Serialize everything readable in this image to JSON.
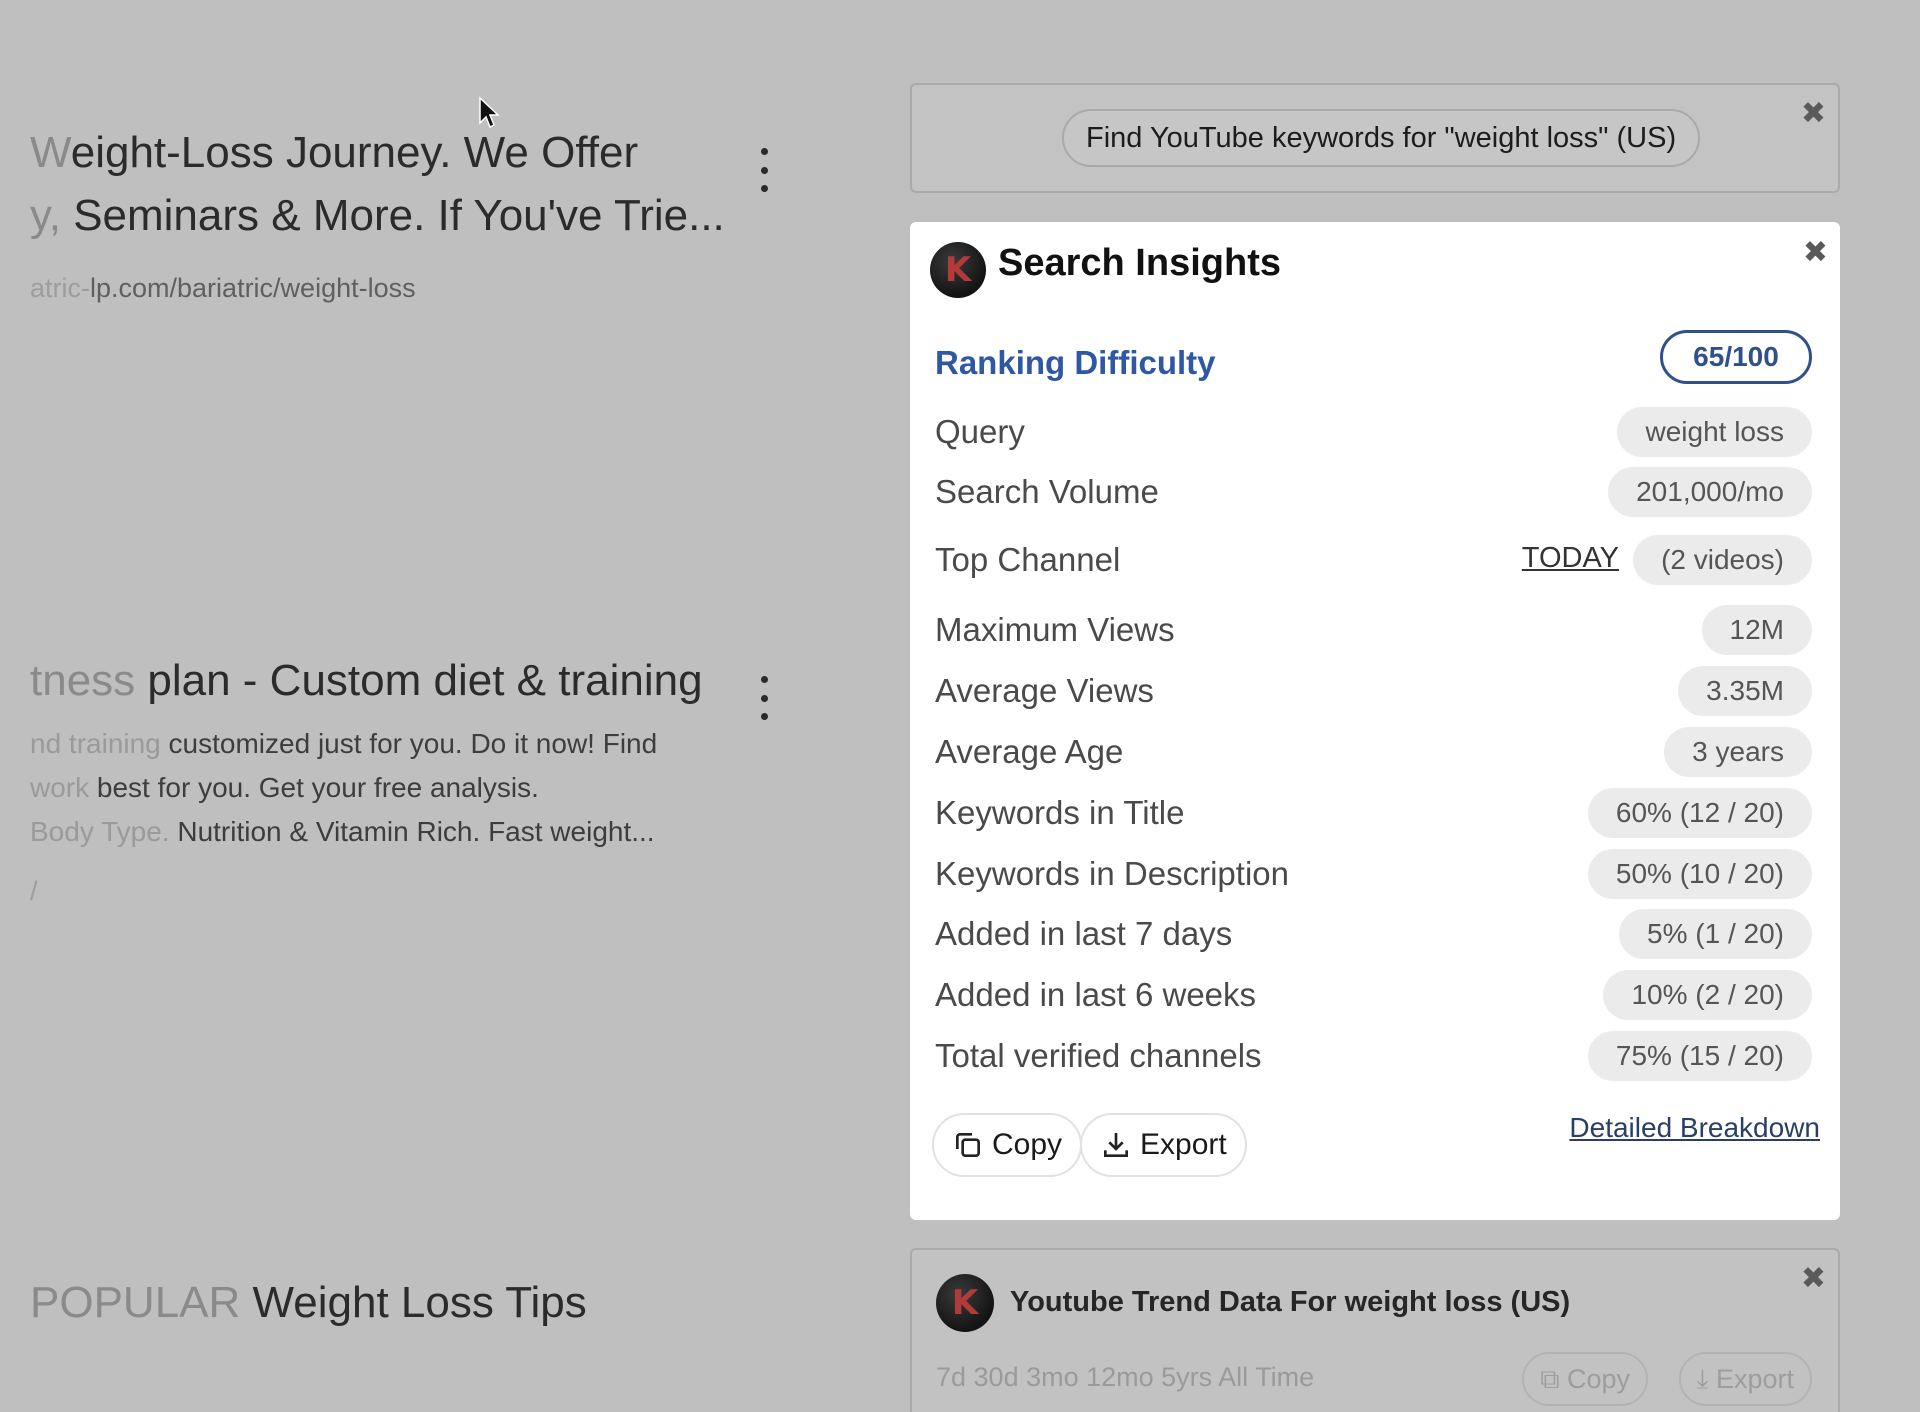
{
  "results": [
    {
      "title_line1_faded": "W",
      "title_line1": "eight-Loss Journey. We Offer",
      "title_line2_faded": "y, ",
      "title_line2": "Seminars & More. If You've Trie...",
      "url_faded": "atric-",
      "url": "lp.com/bariatric/weight-loss"
    },
    {
      "title_faded": "tness",
      "title": " plan - Custom diet & training",
      "desc_line1_faded": "nd training",
      "desc_line1": " customized just for you. Do it now! Find",
      "desc_line2_faded": "work",
      "desc_line2": " best for you. Get your free analysis.",
      "desc_line3_faded": "Body Type.",
      "desc_line3": " Nutrition & Vitamin Rich. Fast weight...",
      "url_faded": "/"
    },
    {
      "title_faded": "POPULAR",
      "title": " Weight Loss Tips"
    }
  ],
  "prompt_card": {
    "prompt_text": "Find YouTube keywords for \"weight loss\" (US)",
    "close_symbol": "✖"
  },
  "insights": {
    "logo_letter": "K",
    "title": "Search Insights",
    "close_symbol": "✖",
    "ranking_difficulty_label": "Ranking Difficulty",
    "ranking_difficulty_score": "65/100",
    "rows": [
      {
        "label": "Query",
        "value": "weight loss"
      },
      {
        "label": "Search Volume",
        "value": "201,000/mo"
      },
      {
        "label": "Top Channel",
        "link": "TODAY",
        "value": "(2 videos)"
      },
      {
        "label": "Maximum Views",
        "value": "12M"
      },
      {
        "label": "Average Views",
        "value": "3.35M"
      },
      {
        "label": "Average Age",
        "value": "3 years"
      },
      {
        "label": "Keywords in Title",
        "value": "60% (12 / 20)"
      },
      {
        "label": "Keywords in Description",
        "value": "50% (10 / 20)"
      },
      {
        "label": "Added in last 7 days",
        "value": "5% (1 / 20)"
      },
      {
        "label": "Added in last 6 weeks",
        "value": "10% (2 / 20)"
      },
      {
        "label": "Total verified channels",
        "value": "75% (15 / 20)"
      }
    ],
    "copy_label": "Copy",
    "export_label": "Export",
    "detailed_link": "Detailed Breakdown"
  },
  "trend_card": {
    "logo_letter": "K",
    "title": "Youtube Trend Data For weight loss (US)",
    "close_symbol": "✖",
    "ranges": "7d  30d  3mo  12mo  5yrs  All Time",
    "copy_label": "Copy",
    "export_label": "Export"
  },
  "icons": {
    "kebab": "kebab-menu-icon",
    "cursor": "mouse-pointer-icon",
    "copy": "copy-icon",
    "export": "download-icon"
  }
}
